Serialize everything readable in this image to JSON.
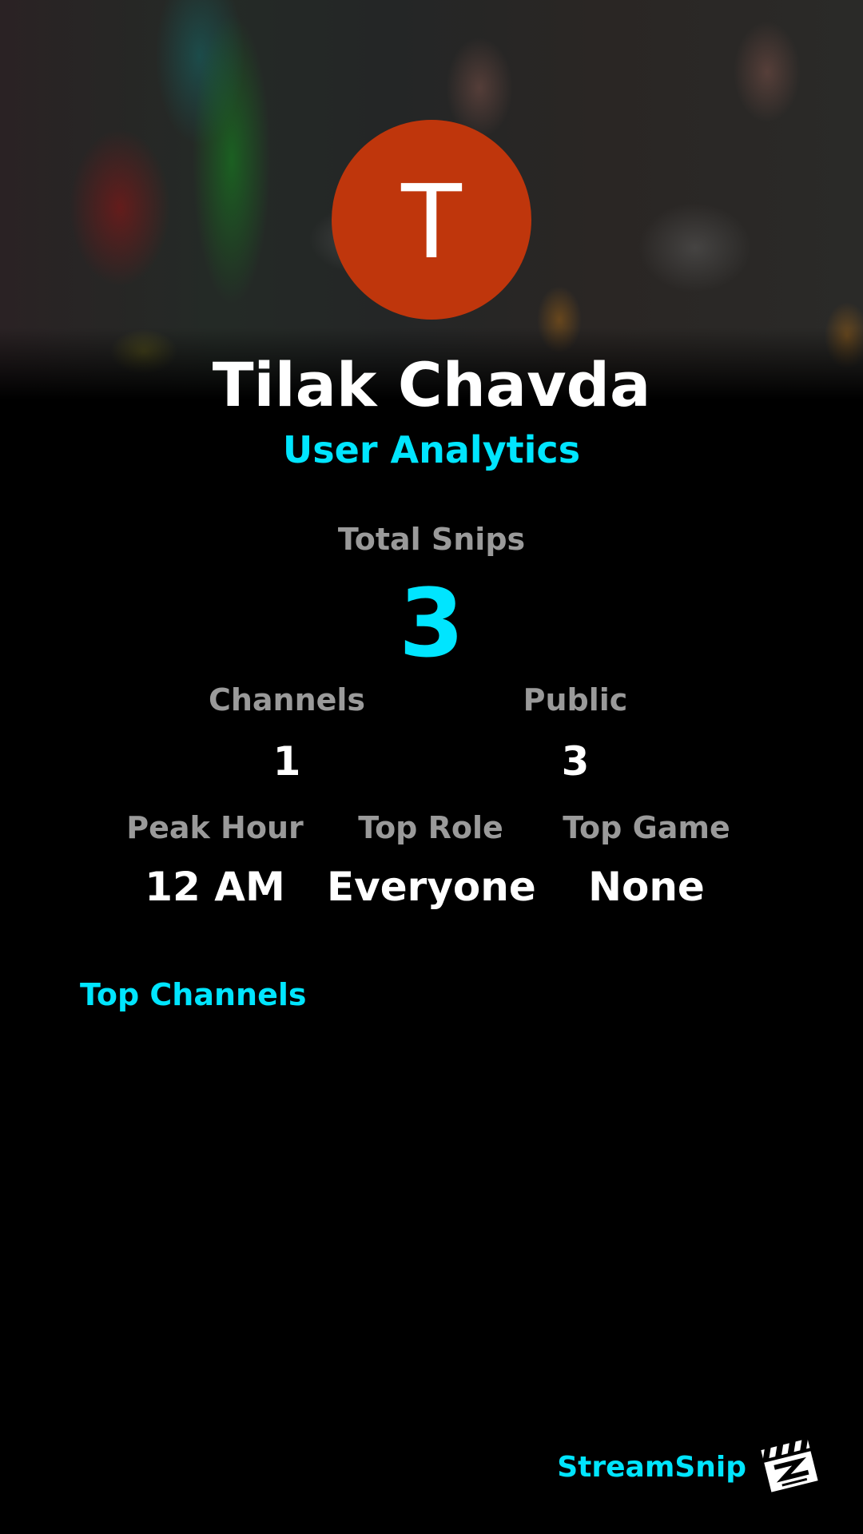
{
  "profile": {
    "avatar_letter": "T",
    "avatar_color": "#bf360c",
    "name": "Tilak Chavda",
    "subtitle": "User Analytics"
  },
  "stats": {
    "total_snips": {
      "label": "Total Snips",
      "value": "3"
    },
    "channels": {
      "label": "Channels",
      "value": "1"
    },
    "public": {
      "label": "Public",
      "value": "3"
    },
    "peak_hour": {
      "label": "Peak Hour",
      "value": "12 AM"
    },
    "top_role": {
      "label": "Top Role",
      "value": "Everyone"
    },
    "top_game": {
      "label": "Top Game",
      "value": "None"
    }
  },
  "sections": {
    "top_channels_title": "Top Channels"
  },
  "brand": {
    "name": "StreamSnip",
    "logo_icon": "clapperboard-icon"
  },
  "colors": {
    "accent": "#00e5ff",
    "background": "#000000",
    "label": "#9a9a9a"
  }
}
